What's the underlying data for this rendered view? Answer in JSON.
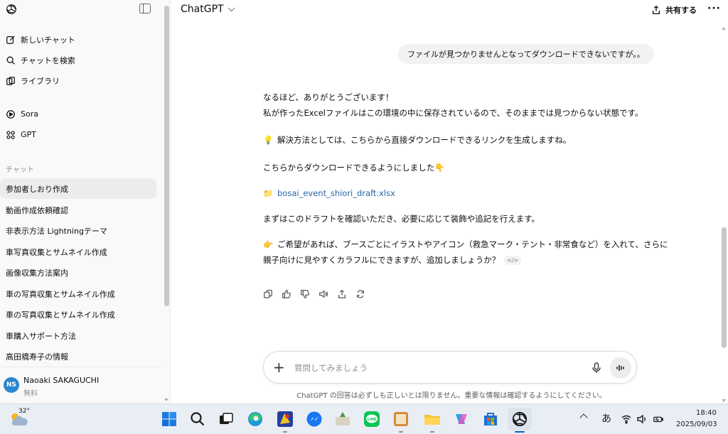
{
  "sidebar": {
    "top_items": [
      {
        "label": "新しいチャット",
        "icon": "new-chat-icon"
      },
      {
        "label": "チャットを検索",
        "icon": "search-icon"
      },
      {
        "label": "ライブラリ",
        "icon": "library-icon"
      }
    ],
    "app_items": [
      {
        "label": "Sora",
        "icon": "sora-icon"
      },
      {
        "label": "GPT",
        "icon": "gpt-grid-icon"
      }
    ],
    "section_label": "チャット",
    "chats": [
      "参加者しおり作成",
      "動画作成依頼確認",
      "非表示方法 Lightningテーマ",
      "車写真収集とサムネイル作成",
      "画像収集方法案内",
      "車の写真収集とサムネイル作成",
      "車の写真収集とサムネイル作成",
      "車購入サポート方法",
      "高田橋寿子の情報"
    ],
    "user": {
      "initials": "NS",
      "name": "Naoaki SAKAGUCHI",
      "plan": "無料"
    }
  },
  "header": {
    "model": "ChatGPT",
    "share_label": "共有する",
    "more_label": "···"
  },
  "conversation": {
    "user_message": "ファイルが見つかりませんとなってダウンロードできないですが。。",
    "assistant": {
      "line1": "なるほど、ありがとうございます！",
      "line2": "私が作ったExcelファイルはこの環境の中に保存されているので、そのままでは見つからない状態です。",
      "tip_emoji": "💡",
      "tip": "解決方法としては、こちらから直接ダウンロードできるリンクを生成しますね。",
      "download_text": "こちらからダウンロードできるようにしました👇",
      "file_emoji": "📁",
      "file_link": "bosai_event_shiori_draft.xlsx",
      "review_text": "まずはこのドラフトを確認いただき、必要に応じて装飾や追記を行えます。",
      "offer_emoji": "👉",
      "offer_line1": "ご希望があれば、ブースごとにイラストやアイコン（救急マーク・テント・非常食など）を入れて、さらに",
      "offer_line2": "親子向けに見やすくカラフルにできますが、追加しましょうか？",
      "code_chip": "</>"
    }
  },
  "composer": {
    "placeholder": "質問してみましょう",
    "plus": "+"
  },
  "disclaimer": "ChatGPT の回答は必ずしも正しいとは限りません。重要な情報は確認するようにしてください。",
  "taskbar": {
    "temperature": "32°",
    "ime": "あ",
    "time": "18:40",
    "date": "2025/09/03"
  },
  "colors": {
    "accent": "#2964aa",
    "avatar": "#2a87d0",
    "taskbar": "#e9eef5"
  }
}
